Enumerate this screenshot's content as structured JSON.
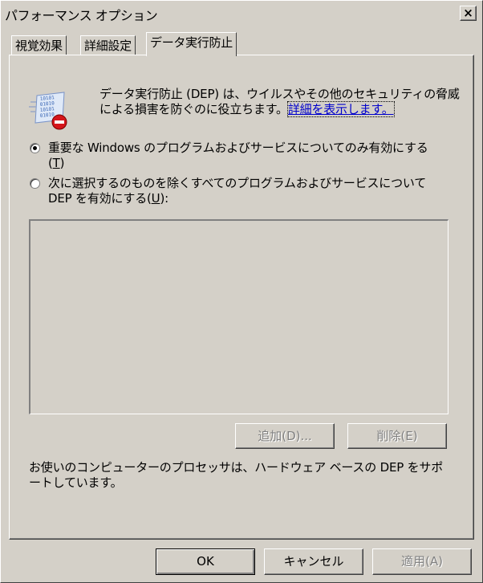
{
  "window": {
    "title": "パフォーマンス オプション",
    "close_label": "×"
  },
  "tabs": [
    {
      "label": "視覚効果",
      "active": false
    },
    {
      "label": "詳細設定",
      "active": false
    },
    {
      "label": "データ実行防止",
      "active": true
    }
  ],
  "dep": {
    "description": "データ実行防止 (DEP) は、ウイルスやその他のセキュリティの脅威による損害を防ぐのに役立ちます。",
    "link_text": "詳細を表示します。",
    "icon_bits": [
      "10101",
      "01010",
      "10101",
      "01010"
    ],
    "options": [
      {
        "label": "重要な Windows のプログラムおよびサービスについてのみ有効にする",
        "accel": "T",
        "checked": true
      },
      {
        "label": "次に選択するのものを除くすべてのプログラムおよびサービスについて DEP を有効にする",
        "accel": "U",
        "checked": false
      }
    ],
    "exceptions": [],
    "add_label": "追加(D)...",
    "remove_label": "削除(E)",
    "support_text": "お使いのコンピューターのプロセッサは、ハードウェア ベースの DEP をサポートしています。"
  },
  "footer": {
    "ok_label": "OK",
    "cancel_label": "キャンセル",
    "apply_label": "適用(A)"
  }
}
